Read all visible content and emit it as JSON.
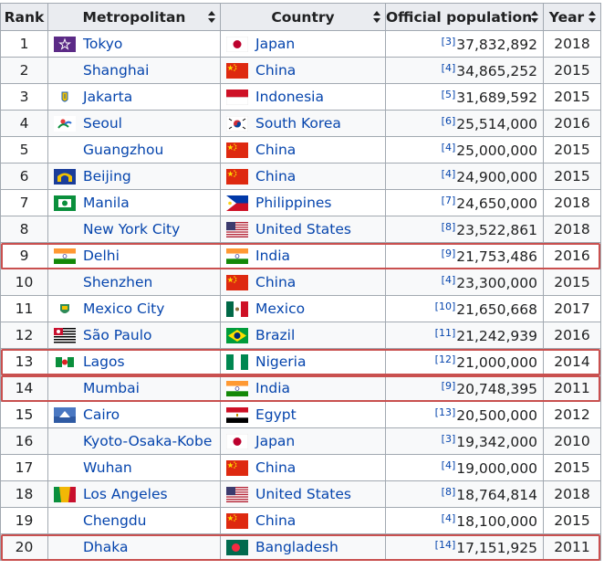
{
  "headers": {
    "rank": "Rank",
    "metropolitan": "Metropolitan",
    "country": "Country",
    "population": "Official population",
    "year": "Year"
  },
  "rows": [
    {
      "rank": "1",
      "city": "Tokyo",
      "city_icon": "tokyo-emblem-icon",
      "country": "Japan",
      "country_flag": "flag-japan-icon",
      "ref": "[3]",
      "population": "37,832,892",
      "year": "2018"
    },
    {
      "rank": "2",
      "city": "Shanghai",
      "city_icon": "",
      "country": "China",
      "country_flag": "flag-china-icon",
      "ref": "[4]",
      "population": "34,865,252",
      "year": "2015"
    },
    {
      "rank": "3",
      "city": "Jakarta",
      "city_icon": "jakarta-emblem-icon",
      "country": "Indonesia",
      "country_flag": "flag-indonesia-icon",
      "ref": "[5]",
      "population": "31,689,592",
      "year": "2015"
    },
    {
      "rank": "4",
      "city": "Seoul",
      "city_icon": "seoul-emblem-icon",
      "country": "South Korea",
      "country_flag": "flag-south-korea-icon",
      "ref": "[6]",
      "population": "25,514,000",
      "year": "2016"
    },
    {
      "rank": "5",
      "city": "Guangzhou",
      "city_icon": "",
      "country": "China",
      "country_flag": "flag-china-icon",
      "ref": "[4]",
      "population": "25,000,000",
      "year": "2015"
    },
    {
      "rank": "6",
      "city": "Beijing",
      "city_icon": "beijing-emblem-icon",
      "country": "China",
      "country_flag": "flag-china-icon",
      "ref": "[4]",
      "population": "24,900,000",
      "year": "2015"
    },
    {
      "rank": "7",
      "city": "Manila",
      "city_icon": "manila-flag-icon",
      "country": "Philippines",
      "country_flag": "flag-philippines-icon",
      "ref": "[7]",
      "population": "24,650,000",
      "year": "2018"
    },
    {
      "rank": "8",
      "city": "New York City",
      "city_icon": "",
      "country": "United States",
      "country_flag": "flag-usa-icon",
      "ref": "[8]",
      "population": "23,522,861",
      "year": "2018"
    },
    {
      "rank": "9",
      "city": "Delhi",
      "city_icon": "flag-india-icon",
      "country": "India",
      "country_flag": "flag-india-icon",
      "ref": "[9]",
      "population": "21,753,486",
      "year": "2016"
    },
    {
      "rank": "10",
      "city": "Shenzhen",
      "city_icon": "",
      "country": "China",
      "country_flag": "flag-china-icon",
      "ref": "[4]",
      "population": "23,300,000",
      "year": "2015"
    },
    {
      "rank": "11",
      "city": "Mexico City",
      "city_icon": "mexico-city-emblem-icon",
      "country": "Mexico",
      "country_flag": "flag-mexico-icon",
      "ref": "[10]",
      "population": "21,650,668",
      "year": "2017"
    },
    {
      "rank": "12",
      "city": "São Paulo",
      "city_icon": "sao-paulo-flag-icon",
      "country": "Brazil",
      "country_flag": "flag-brazil-icon",
      "ref": "[11]",
      "population": "21,242,939",
      "year": "2016"
    },
    {
      "rank": "13",
      "city": "Lagos",
      "city_icon": "lagos-flag-icon",
      "country": "Nigeria",
      "country_flag": "flag-nigeria-icon",
      "ref": "[12]",
      "population": "21,000,000",
      "year": "2014"
    },
    {
      "rank": "14",
      "city": "Mumbai",
      "city_icon": "",
      "country": "India",
      "country_flag": "flag-india-icon",
      "ref": "[9]",
      "population": "20,748,395",
      "year": "2011"
    },
    {
      "rank": "15",
      "city": "Cairo",
      "city_icon": "cairo-flag-icon",
      "country": "Egypt",
      "country_flag": "flag-egypt-icon",
      "ref": "[13]",
      "population": "20,500,000",
      "year": "2012"
    },
    {
      "rank": "16",
      "city": "Kyoto-Osaka-Kobe",
      "city_icon": "",
      "country": "Japan",
      "country_flag": "flag-japan-icon",
      "ref": "[3]",
      "population": "19,342,000",
      "year": "2010"
    },
    {
      "rank": "17",
      "city": "Wuhan",
      "city_icon": "",
      "country": "China",
      "country_flag": "flag-china-icon",
      "ref": "[4]",
      "population": "19,000,000",
      "year": "2015"
    },
    {
      "rank": "18",
      "city": "Los Angeles",
      "city_icon": "los-angeles-flag-icon",
      "country": "United States",
      "country_flag": "flag-usa-icon",
      "ref": "[8]",
      "population": "18,764,814",
      "year": "2018"
    },
    {
      "rank": "19",
      "city": "Chengdu",
      "city_icon": "",
      "country": "China",
      "country_flag": "flag-china-icon",
      "ref": "[4]",
      "population": "18,100,000",
      "year": "2015"
    },
    {
      "rank": "20",
      "city": "Dhaka",
      "city_icon": "",
      "country": "Bangladesh",
      "country_flag": "flag-bangladesh-icon",
      "ref": "[14]",
      "population": "17,151,925",
      "year": "2011"
    }
  ],
  "highlighted_ranks": [
    "9",
    "13",
    "14",
    "20"
  ],
  "colors": {
    "link": "#0645ad",
    "header_bg": "#eaecf0",
    "border": "#a2a9b1",
    "highlight": "#c9504f"
  }
}
